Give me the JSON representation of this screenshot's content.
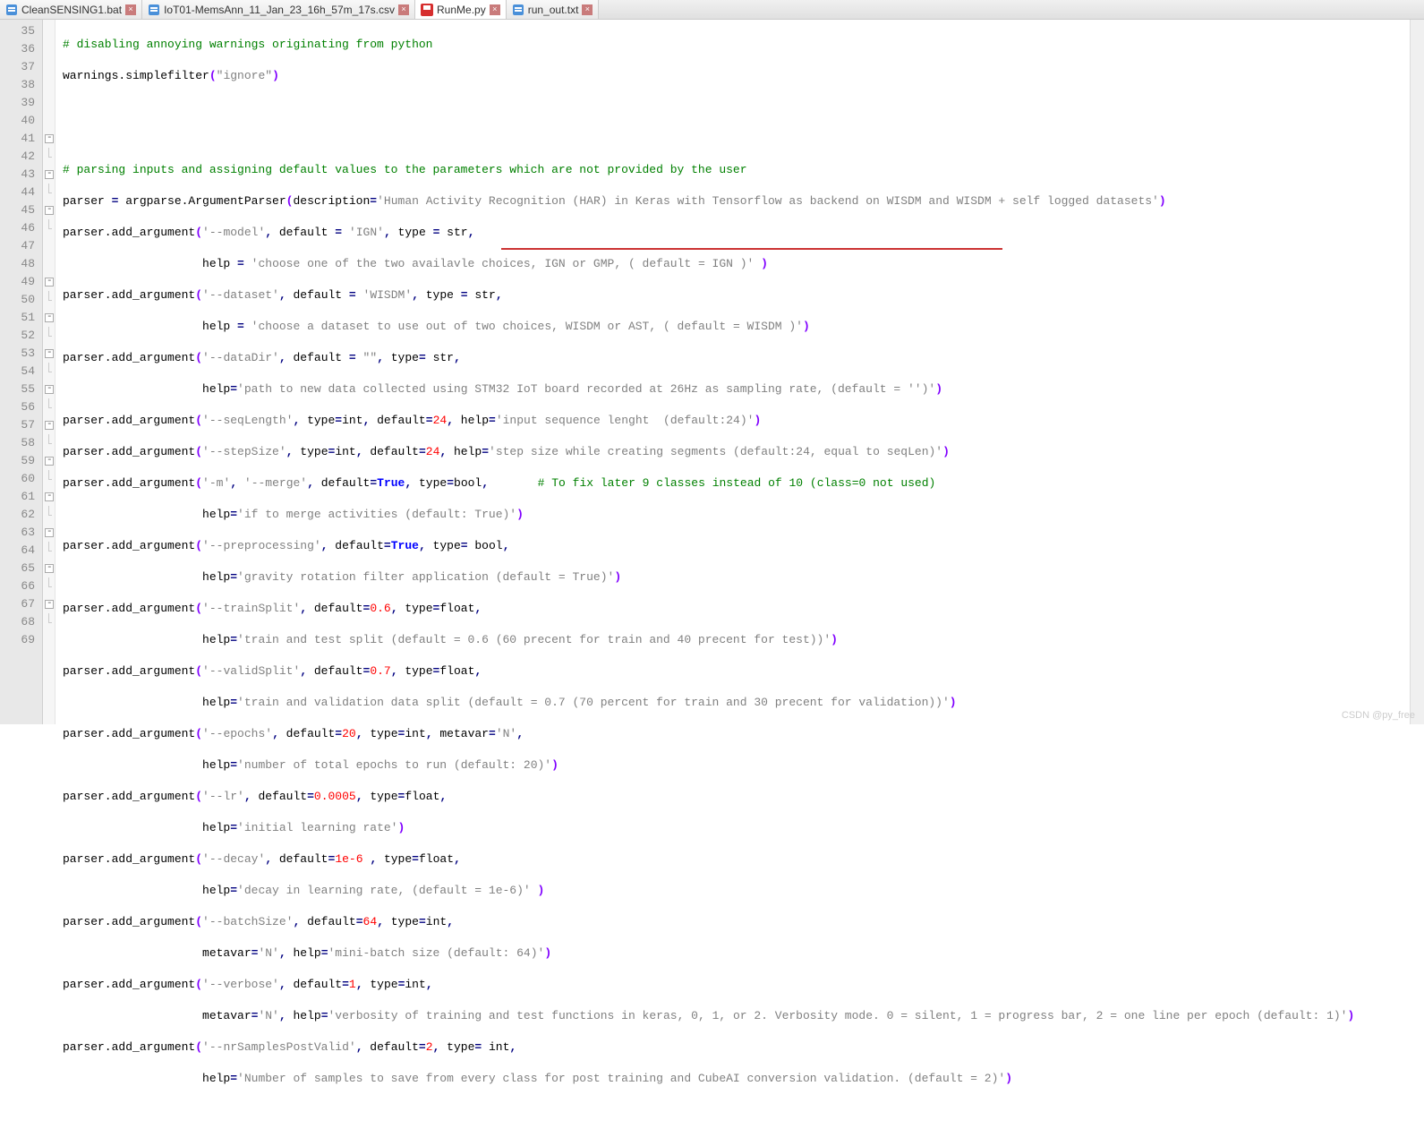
{
  "tabs": [
    {
      "label": "CleanSENSING1.bat",
      "icon": "file-blue",
      "active": false
    },
    {
      "label": "IoT01-MemsAnn_11_Jan_23_16h_57m_17s.csv",
      "icon": "file-blue",
      "active": false
    },
    {
      "label": "RunMe.py",
      "icon": "file-save",
      "active": true
    },
    {
      "label": "run_out.txt",
      "icon": "file-blue",
      "active": false
    }
  ],
  "line_start": 35,
  "line_end": 69,
  "code": {
    "l35": "# disabling annoying warnings originating from python",
    "l36a": "warnings.simplefilter",
    "l36b": "(",
    "l36c": "\"ignore\"",
    "l36d": ")",
    "l39": "# parsing inputs and assigning default values to the parameters which are not provided by the user",
    "l40a": "parser ",
    "l40b": "=",
    "l40c": " argparse.ArgumentParser",
    "l40d": "(",
    "l40e": "description",
    "l40f": "=",
    "l40g": "'Human Activity Recognition (HAR) in Keras with Tensorflow as backend on WISDM and WISDM + self logged datasets'",
    "l40h": ")",
    "l41a": "parser.add_argument",
    "l41b": "(",
    "l41c": "'--model'",
    "l41d": ",",
    "l41e": " default ",
    "l41f": "=",
    "l41g": " ",
    "l41h": "'IGN'",
    "l41i": ",",
    "l41j": " type ",
    "l41k": "=",
    "l41l": " str",
    "l41m": ",",
    "l42a": "                    help ",
    "l42b": "=",
    "l42c": " ",
    "l42d": "'choose one of the two availavle choices, IGN or GMP, ( default = IGN )'",
    "l42e": " )",
    "l43c": "'--dataset'",
    "l43h": "'WISDM'",
    "l44d": "'choose a dataset to use out of two choices, WISDM or AST, ( default = WISDM )'",
    "l44e": ")",
    "l45c": "'--dataDir'",
    "l45h": "\"\"",
    "l45j": " type",
    "l45l": " str",
    "l46a": "                    help",
    "l46d": "'path to new data collected using STM32 IoT board recorded at 26Hz as sampling rate, (default = '')'",
    "l46e": ")",
    "l47c": "'--seqLength'",
    "l47e": " type",
    "l47g": "int",
    "l47i": " default",
    "l47k": "24",
    "l47m": " help",
    "l47o": "'input sequence lenght  (default:24)'",
    "l47p": ")",
    "l48c": "'--stepSize'",
    "l48o": "'step size while creating segments (default:24, equal to seqLen)'",
    "l49c": "'-m'",
    "l49e": "'--merge'",
    "l49g": " default",
    "l49i": "True",
    "l49k": " type",
    "l49m": "bool",
    "l49o": "# To fix later 9 classes instead of 10 (class=0 not used)",
    "l50d": "'if to merge activities (default: True)'",
    "l51c": "'--preprocessing'",
    "l51i": "True",
    "l51m": " bool",
    "l52d": "'gravity rotation filter application (default = True)'",
    "l53c": "'--trainSplit'",
    "l53k": "0.6",
    "l53m": "float",
    "l54d": "'train and test split (default = 0.6 (60 precent for train and 40 precent for test))'",
    "l55c": "'--validSplit'",
    "l55k": "0.7",
    "l56d": "'train and validation data split (default = 0.7 (70 percent for train and 30 precent for validation))'",
    "l57c": "'--epochs'",
    "l57k": "20",
    "l57m": "int",
    "l57o": " metavar",
    "l57q": "'N'",
    "l58d": "'number of total epochs to run (default: 20)'",
    "l59c": "'--lr'",
    "l59k": "0.0005",
    "l60d": "'initial learning rate'",
    "l61c": "'--decay'",
    "l61k": "1e-6",
    "l62d": "'decay in learning rate, (default = 1e-6)'",
    "l63c": "'--batchSize'",
    "l63k": "64",
    "l64a": "                    metavar",
    "l64c": "'N'",
    "l64e": " help",
    "l64g": "'mini-batch size (default: 64)'",
    "l65c": "'--verbose'",
    "l65k": "1",
    "l66c": "'N'",
    "l66g": "'verbosity of training and test functions in keras, 0, 1, or 2. Verbosity mode. 0 = silent, 1 = progress bar, 2 = one line per epoch (default: 1)'",
    "l67c": "'--nrSamplesPostValid'",
    "l67k": "2",
    "l67m": " int",
    "l68d": "'Number of samples to save from every class for post training and CubeAI conversion validation. (default = 2)'"
  },
  "watermark": "CSDN @py_free"
}
